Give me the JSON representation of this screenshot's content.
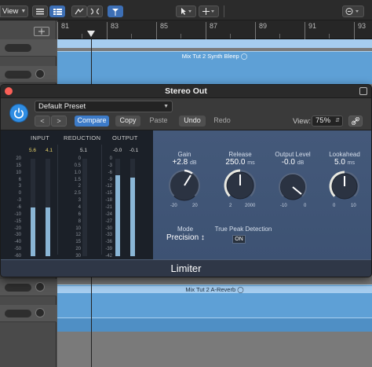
{
  "toolbar": {
    "view_label": "View"
  },
  "ruler": {
    "bars": [
      "81",
      "83",
      "85",
      "87",
      "89",
      "91",
      "93"
    ]
  },
  "regions": {
    "top_label": "Mix Tut 2 Synth Bleep",
    "bottom_label": "Mix Tut 2 A-Reverb"
  },
  "plugin": {
    "title": "Stereo Out",
    "preset": "Default Preset",
    "buttons": {
      "prev": "<",
      "next": ">",
      "compare": "Compare",
      "copy": "Copy",
      "paste": "Paste",
      "undo": "Undo",
      "redo": "Redo"
    },
    "view_label": "View:",
    "view_zoom": "75%",
    "name": "Limiter",
    "meters": {
      "input_label": "INPUT",
      "reduction_label": "REDUCTION",
      "output_label": "OUTPUT",
      "input_peaks": [
        "5.6",
        "4.1"
      ],
      "reduction_peak": "5.1",
      "output_peaks": [
        "-0.0",
        "-0.1"
      ],
      "input_scale": [
        "20",
        "15",
        "10",
        "6",
        "3",
        "0",
        "-3",
        "-6",
        "-10",
        "-15",
        "-20",
        "-30",
        "-40",
        "-50",
        "-60"
      ],
      "reduction_scale": [
        "0",
        "0.5",
        "1.0",
        "1.5",
        "2",
        "2.5",
        "3",
        "4",
        "6",
        "8",
        "10",
        "12",
        "15",
        "20",
        "30"
      ],
      "output_scale": [
        "0",
        "-3",
        "-6",
        "-9",
        "-12",
        "-15",
        "-18",
        "-21",
        "-24",
        "-27",
        "-30",
        "-33",
        "-36",
        "-39",
        "-42"
      ],
      "input_levels": [
        0.5,
        0.5
      ],
      "reduction_level": 0,
      "output_levels": [
        0.83,
        0.81
      ]
    },
    "controls": {
      "gain": {
        "label": "Gain",
        "value": "+2.8",
        "unit": "dB",
        "min": "-20",
        "max": "20"
      },
      "release": {
        "label": "Release",
        "value": "250.0",
        "unit": "ms",
        "min": "2",
        "max": "2000"
      },
      "output_level": {
        "label": "Output Level",
        "value": "-0.0",
        "unit": "dB",
        "min": "-10",
        "max": "0"
      },
      "lookahead": {
        "label": "Lookahead",
        "value": "5.0",
        "unit": "ms",
        "min": "0",
        "max": "10"
      }
    },
    "mode": {
      "label": "Mode",
      "value": "Precision",
      "suffix": "↕"
    },
    "true_peak": {
      "label": "True Peak Detection",
      "value": "ON"
    }
  },
  "colors": {
    "accent_blue": "#3d7bc8",
    "region_blue": "#5ea0d6",
    "meter_bar": "#8ab6d6",
    "panel_bg": "#44597a"
  }
}
